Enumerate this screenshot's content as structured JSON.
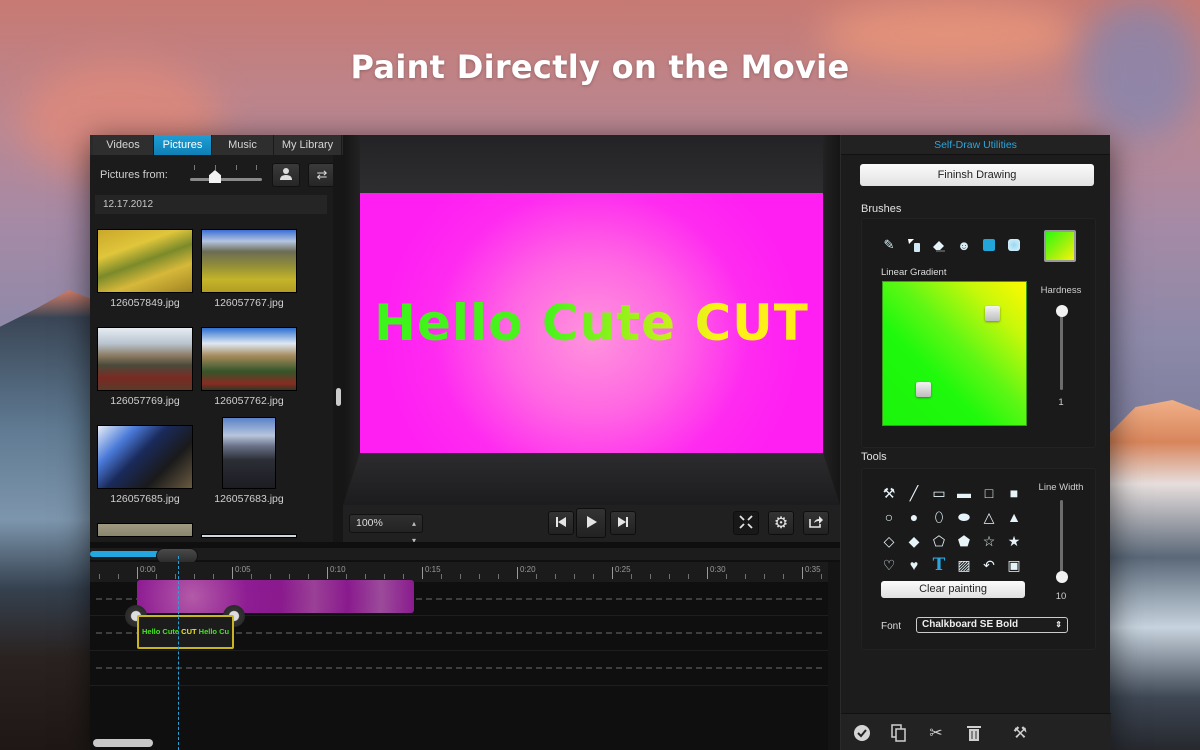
{
  "headline": "Paint Directly on the Movie",
  "library": {
    "tabs": [
      {
        "label": "Videos",
        "active": false
      },
      {
        "label": "Pictures",
        "active": true
      },
      {
        "label": "Music",
        "active": false
      },
      {
        "label": "My Library",
        "active": false
      }
    ],
    "pictures_from_label": "Pictures from:",
    "pictures_from_slider": 0.5,
    "person_icon": "person-icon",
    "refresh_icon": "refresh-icon",
    "date_group": "12.17.2012",
    "thumbnails": [
      {
        "name": "126057849.jpg"
      },
      {
        "name": "126057767.jpg"
      },
      {
        "name": "126057769.jpg"
      },
      {
        "name": "126057762.jpg"
      },
      {
        "name": "126057685.jpg"
      },
      {
        "name": "126057683.jpg"
      }
    ]
  },
  "preview": {
    "overlay_text_parts": [
      "Hello Cute CUT"
    ],
    "overlay_text": "Hello Cute CUT",
    "background_color": "#ff2bf0",
    "zoom_value": "100%",
    "controls": {
      "prev_icon": "skip-back-icon",
      "play_icon": "play-icon",
      "next_icon": "skip-forward-icon",
      "fullscreen_icon": "fullscreen-icon",
      "settings_icon": "gear-icon",
      "export_icon": "share-icon"
    }
  },
  "self_draw": {
    "title": "Self-Draw Utilities",
    "finish_label": "Fininsh Drawing",
    "brushes_label": "Brushes",
    "brush_icons": [
      "pencil-icon",
      "spray-icon",
      "eraser-icon",
      "smiley-icon",
      "square-brush-icon",
      "soft-brush-icon"
    ],
    "gradient_label": "Linear Gradient",
    "gradient_colors": [
      "#1ef90c",
      "#fff900"
    ],
    "hardness_label": "Hardness",
    "hardness_value": "1",
    "hardness_fraction": 1.0,
    "tools_label": "Tools",
    "line_width_label": "Line Width",
    "line_width_value": "10",
    "line_width_fraction": 0.0,
    "tool_icons": [
      "brush-tool-icon",
      "line-icon",
      "rectangle-outline-icon",
      "rectangle-filled-icon",
      "square-outline-icon",
      "square-filled-icon",
      "circle-outline-icon",
      "circle-filled-icon",
      "ellipse-outline-icon",
      "ellipse-filled-icon",
      "triangle-outline-icon",
      "triangle-filled-icon",
      "diamond-outline-icon",
      "diamond-filled-icon",
      "pentagon-outline-icon",
      "pentagon-filled-icon",
      "star-outline-icon",
      "star-filled-icon",
      "heart-outline-icon",
      "heart-filled-icon",
      "text-icon",
      "image-icon",
      "undo-icon",
      "save-icon"
    ],
    "clear_label": "Clear painting",
    "font_label": "Font",
    "font_value": "Chalkboard SE Bold",
    "bottom_icons": [
      "check-icon",
      "copy-icon",
      "scissors-icon",
      "trash-icon",
      "tools-icon"
    ]
  },
  "timeline": {
    "progress_fraction": 0.1,
    "ruler_labels": [
      "0:00",
      "0:05",
      "0:10",
      "0:15",
      "0:20",
      "0:25",
      "0:30",
      "0:35"
    ],
    "text_clip": {
      "part1": "Hello Cute ",
      "part2": "CUT",
      "part3": "  Hello Cu"
    }
  }
}
